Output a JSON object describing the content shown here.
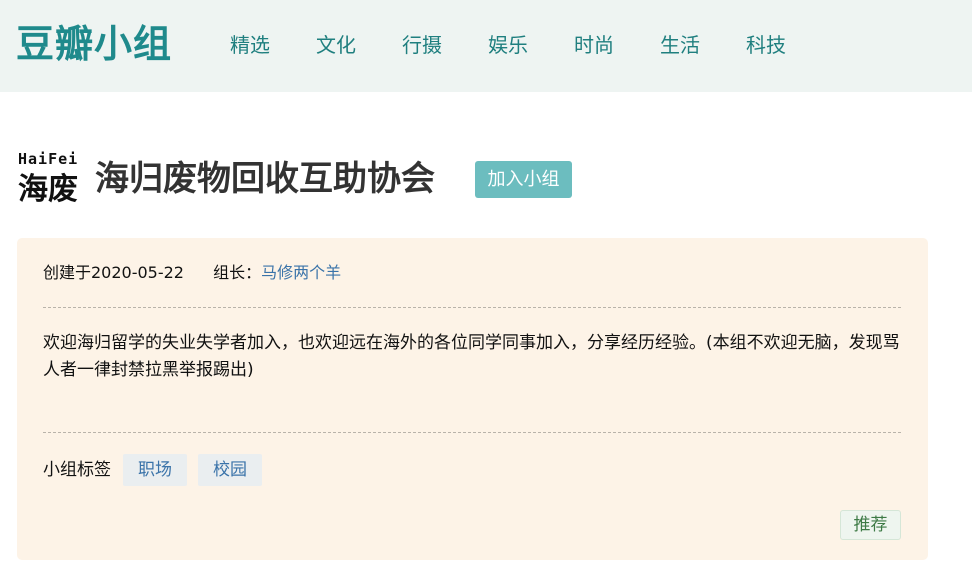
{
  "header": {
    "logo": "豆瓣小组",
    "nav": [
      "精选",
      "文化",
      "行摄",
      "娱乐",
      "时尚",
      "生活",
      "科技"
    ]
  },
  "group": {
    "badge_en": "HaiFei",
    "badge_cn": "海废",
    "title": "海归废物回收互助协会",
    "join_label": "加入小组"
  },
  "info": {
    "created": "创建于2020-05-22",
    "owner_label": "组长：",
    "owner_name": "马修两个羊",
    "description": "欢迎海归留学的失业失学者加入，也欢迎远在海外的各位同学同事加入，分享经历经验。(本组不欢迎无脑，发现骂人者一律封禁拉黑举报踢出)",
    "tags_label": "小组标签",
    "tags": [
      "职场",
      "校园"
    ],
    "recommend_label": "推荐"
  },
  "colors": {
    "brand": "#1f8a8c",
    "header_bg": "#eef4f2",
    "join_button": "#6cbdbf",
    "card_bg": "#fdf3e7",
    "link": "#3a73a9"
  }
}
